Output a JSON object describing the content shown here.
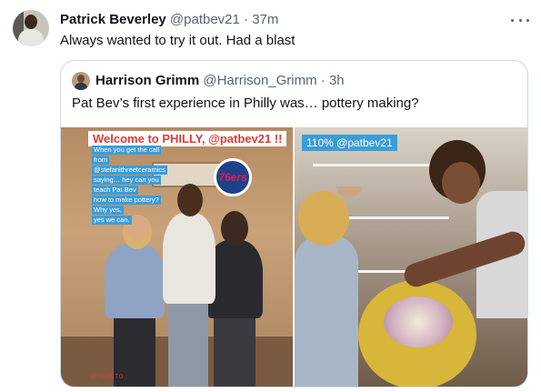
{
  "tweet": {
    "author_name": "Patrick Beverley",
    "author_handle": "@patbev21",
    "separator": "·",
    "time": "37m",
    "text": "Always wanted to try it out. Had a blast"
  },
  "quoted_tweet": {
    "author_name": "Harrison Grimm",
    "author_handle": "@Harrison_Grimm",
    "separator": "·",
    "time": "3h",
    "text": "Pat Bev’s first experience in Philly was… pottery making?"
  },
  "media": {
    "image1": {
      "overlay_title": "Welcome to PHILLY, @patbev21 !!",
      "overlay_lines": [
        "When you get the call",
        "from",
        "@stefanithreetceramics",
        "saying… hey can you",
        "teach Pat Bev",
        "how to make pottery?",
        "Why yes,",
        "yes we can."
      ],
      "logo_text": "76ers",
      "footer": "BE SURE TO..."
    },
    "image2": {
      "overlay_tag": "110% @patbev21"
    }
  },
  "icons": {
    "more": "more-horizontal-icon"
  }
}
